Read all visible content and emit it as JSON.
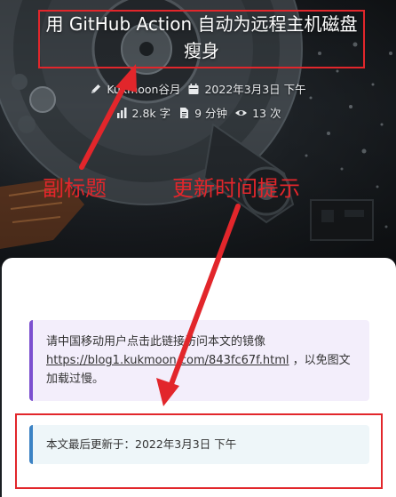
{
  "post": {
    "title": "用 GitHub Action 自动为远程主机磁盘瘦身",
    "author": "Kukmoon谷月",
    "date": "2022年3月3日 下午",
    "word_count": "2.8k 字",
    "read_time": "9 分钟",
    "views": "13 次"
  },
  "notice": {
    "text_before": "请中国移动用户点击此链接访问本文的镜像",
    "link": "https://blog1.kukmoon.com/843fc67f.html",
    "text_after": "，以免图文加载过慢。"
  },
  "update": {
    "text": "本文最后更新于：2022年3月3日 下午"
  },
  "annotations": {
    "subtitle_label": "副标题",
    "update_label": "更新时间提示",
    "color": "#e2262b"
  },
  "colors": {
    "notice_accent": "#7b4fcf",
    "update_accent": "#3b82c4"
  }
}
